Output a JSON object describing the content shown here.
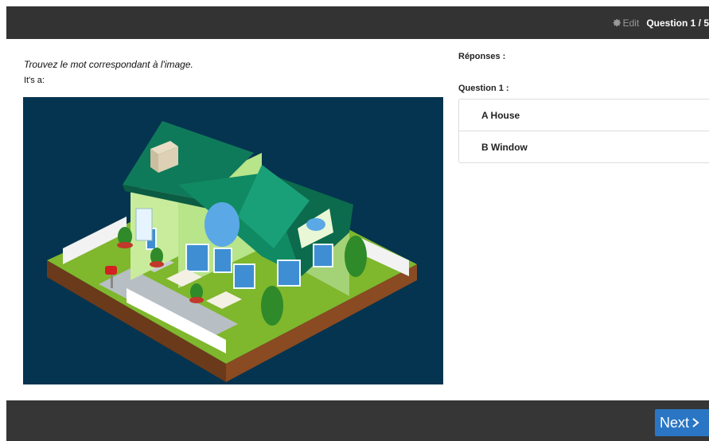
{
  "header": {
    "edit_label": "Edit",
    "edit_icon": "gear-icon",
    "question_counter": "Question 1 / 5"
  },
  "main": {
    "instruction": "Trouvez le mot correspondant à l'image.",
    "prompt": "It's a:",
    "image": "isometric-house-illustration"
  },
  "answers": {
    "title": "Réponses :",
    "question_label": "Question 1 :",
    "options": [
      {
        "letter": "A",
        "text": "House",
        "label": "A House"
      },
      {
        "letter": "B",
        "text": "Window",
        "label": "B Window"
      }
    ]
  },
  "footer": {
    "next_label": "Next",
    "next_icon": "chevron-right-icon"
  },
  "colors": {
    "topbar": "#333333",
    "bottombar": "#363636",
    "image_bg": "#04344f",
    "next_button": "#2a76c4"
  }
}
